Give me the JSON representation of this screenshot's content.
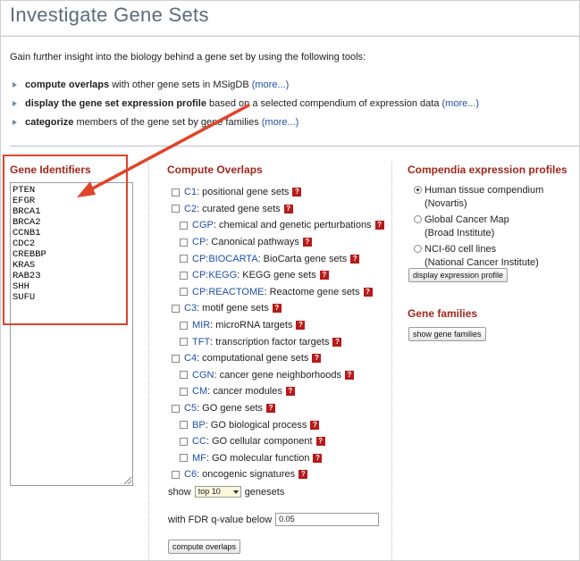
{
  "page": {
    "title": "Investigate Gene Sets",
    "intro": "Gain further insight into the biology behind a gene set by using the following tools:"
  },
  "tools": [
    {
      "bold": "compute overlaps",
      "rest": " with other gene sets in MSigDB ",
      "more": "(more...)"
    },
    {
      "bold": "display the gene set expression profile",
      "rest": " based on a selected compendium of expression data ",
      "more": "(more...)"
    },
    {
      "bold": "categorize",
      "rest": " members of the gene set by gene families ",
      "more": "(more...)"
    }
  ],
  "gene_identifiers": {
    "header": "Gene Identifiers",
    "genes": [
      "PTEN",
      "EFGR",
      "BRCA1",
      "BRCA2",
      "CCNB1",
      "CDC2",
      "CREBBP",
      "KRAS",
      "RAB23",
      "SHH",
      "SUFU"
    ]
  },
  "compute_overlaps": {
    "header": "Compute Overlaps",
    "collections": [
      {
        "code": "C1",
        "label": ": positional gene sets",
        "level": 0
      },
      {
        "code": "C2",
        "label": ": curated gene sets",
        "level": 0
      },
      {
        "code": "CGP",
        "label": ": chemical and genetic perturbations",
        "level": 1
      },
      {
        "code": "CP",
        "label": ": Canonical pathways",
        "level": 1
      },
      {
        "code": "CP:BIOCARTA",
        "label": ": BioCarta gene sets",
        "level": 1
      },
      {
        "code": "CP:KEGG",
        "label": ": KEGG gene sets",
        "level": 1
      },
      {
        "code": "CP:REACTOME",
        "label": ": Reactome gene sets",
        "level": 1
      },
      {
        "code": "C3",
        "label": ": motif gene sets",
        "level": 0
      },
      {
        "code": "MIR",
        "label": ": microRNA targets",
        "level": 1
      },
      {
        "code": "TFT",
        "label": ": transcription factor targets",
        "level": 1
      },
      {
        "code": "C4",
        "label": ": computational gene sets",
        "level": 0
      },
      {
        "code": "CGN",
        "label": ": cancer gene neighborhoods",
        "level": 1
      },
      {
        "code": "CM",
        "label": ": cancer modules",
        "level": 1
      },
      {
        "code": "C5",
        "label": ": GO gene sets",
        "level": 0
      },
      {
        "code": "BP",
        "label": ": GO biological process",
        "level": 1
      },
      {
        "code": "CC",
        "label": ": GO cellular component",
        "level": 1
      },
      {
        "code": "MF",
        "label": ": GO molecular function",
        "level": 1
      },
      {
        "code": "C6",
        "label": ": oncogenic signatures",
        "level": 0
      }
    ],
    "help_icon": "?",
    "show_label": "show",
    "show_value": "top 10",
    "genesets_label": "genesets",
    "fdr_label": "with FDR q-value below",
    "fdr_value": "0.05",
    "button": "compute overlaps"
  },
  "compendia": {
    "header": "Compendia expression profiles",
    "options": [
      {
        "line1": "Human tissue compendium",
        "line2": "(Novartis)",
        "selected": true
      },
      {
        "line1": "Global Cancer Map",
        "line2": "(Broad Institute)",
        "selected": false
      },
      {
        "line1": "NCI-60 cell lines",
        "line2": "(National Cancer Institute)",
        "selected": false
      }
    ],
    "button": "display expression profile"
  },
  "gene_families": {
    "header": "Gene families",
    "button": "show gene families"
  },
  "colors": {
    "header_red": "#a0271c",
    "link_blue": "#1f4fa8",
    "annotation_red": "#e0442b"
  }
}
